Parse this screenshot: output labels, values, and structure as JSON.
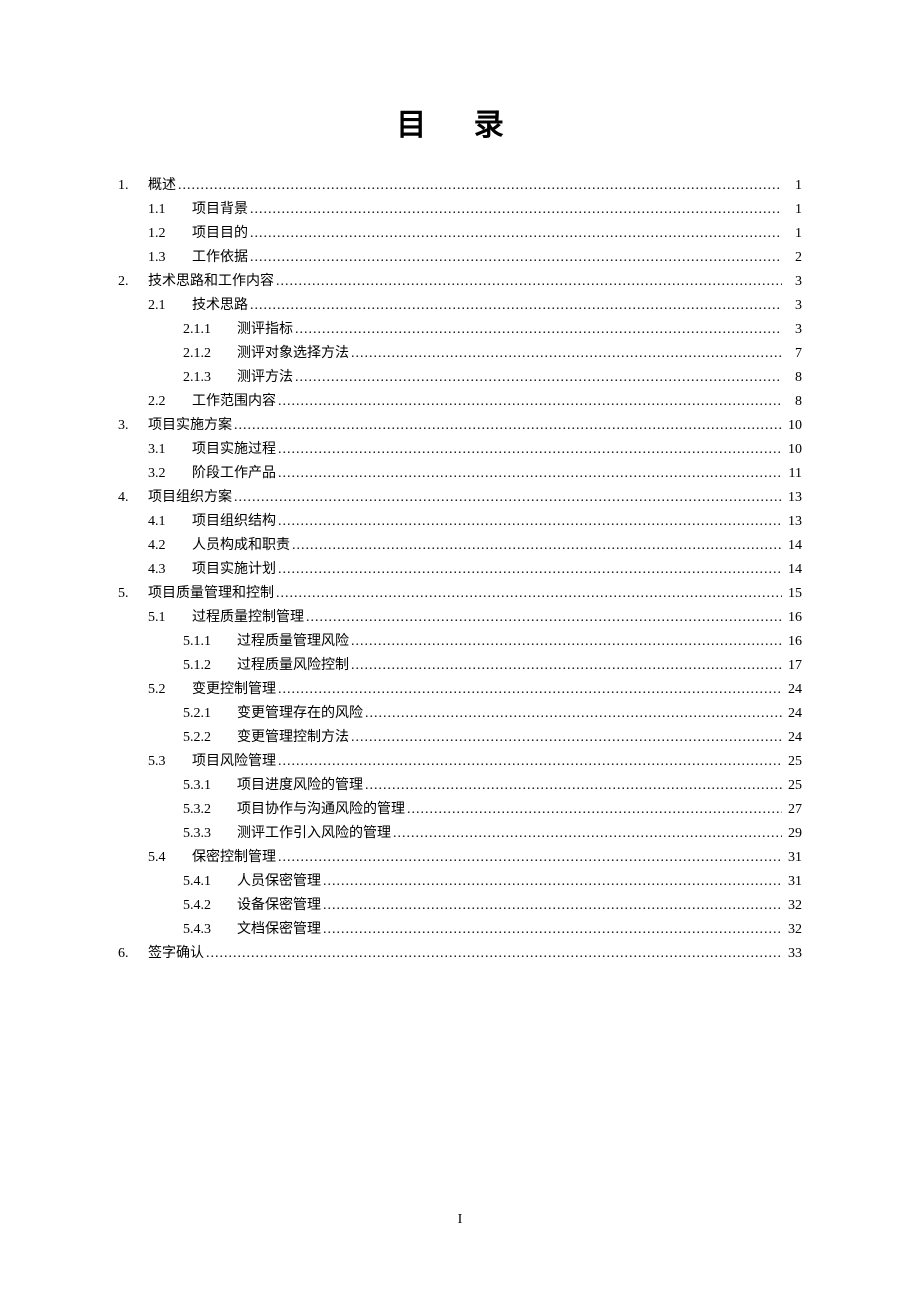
{
  "title": "目 录",
  "footer": "I",
  "entries": [
    {
      "top": "1.",
      "label": "概述",
      "page": "1"
    },
    {
      "sub": "1.1",
      "label": "项目背景",
      "page": "1",
      "indent": 1
    },
    {
      "sub": "1.2",
      "label": "项目目的",
      "page": "1",
      "indent": 1
    },
    {
      "sub": "1.3",
      "label": "工作依据",
      "page": "2",
      "indent": 1
    },
    {
      "top": "2.",
      "label": "技术思路和工作内容",
      "page": "3"
    },
    {
      "sub": "2.1",
      "label": "技术思路",
      "page": "3",
      "indent": 1
    },
    {
      "sub": "2.1.1",
      "label": "测评指标",
      "page": "3",
      "indent": 2
    },
    {
      "sub": "2.1.2",
      "label": "测评对象选择方法",
      "page": "7",
      "indent": 2
    },
    {
      "sub": "2.1.3",
      "label": "测评方法",
      "page": "8",
      "indent": 2
    },
    {
      "sub": "2.2",
      "label": "工作范围内容",
      "page": "8",
      "indent": 1
    },
    {
      "top": "3.",
      "label": "项目实施方案",
      "page": "10"
    },
    {
      "sub": "3.1",
      "label": "项目实施过程",
      "page": "10",
      "indent": 1
    },
    {
      "sub": "3.2",
      "label": "阶段工作产品",
      "page": "11",
      "indent": 1
    },
    {
      "top": "4.",
      "label": "项目组织方案",
      "page": "13"
    },
    {
      "sub": "4.1",
      "label": "项目组织结构",
      "page": "13",
      "indent": 1
    },
    {
      "sub": "4.2",
      "label": "人员构成和职责",
      "page": "14",
      "indent": 1
    },
    {
      "sub": "4.3",
      "label": "项目实施计划",
      "page": "14",
      "indent": 1
    },
    {
      "top": "5.",
      "label": "项目质量管理和控制",
      "page": "15"
    },
    {
      "sub": "5.1",
      "label": "过程质量控制管理",
      "page": "16",
      "indent": 1
    },
    {
      "sub": "5.1.1",
      "label": "过程质量管理风险",
      "page": "16",
      "indent": 2
    },
    {
      "sub": "5.1.2",
      "label": "过程质量风险控制",
      "page": "17",
      "indent": 2
    },
    {
      "sub": "5.2",
      "label": "变更控制管理",
      "page": "24",
      "indent": 1
    },
    {
      "sub": "5.2.1",
      "label": "变更管理存在的风险",
      "page": "24",
      "indent": 2
    },
    {
      "sub": "5.2.2",
      "label": "变更管理控制方法",
      "page": "24",
      "indent": 2
    },
    {
      "sub": "5.3",
      "label": "项目风险管理",
      "page": "25",
      "indent": 1
    },
    {
      "sub": "5.3.1",
      "label": "项目进度风险的管理",
      "page": "25",
      "indent": 2
    },
    {
      "sub": "5.3.2",
      "label": "项目协作与沟通风险的管理",
      "page": "27",
      "indent": 2
    },
    {
      "sub": "5.3.3",
      "label": "测评工作引入风险的管理",
      "page": "29",
      "indent": 2
    },
    {
      "sub": "5.4",
      "label": "保密控制管理",
      "page": "31",
      "indent": 1
    },
    {
      "sub": "5.4.1",
      "label": "人员保密管理",
      "page": "31",
      "indent": 2
    },
    {
      "sub": "5.4.2",
      "label": "设备保密管理",
      "page": "32",
      "indent": 2
    },
    {
      "sub": "5.4.3",
      "label": "文档保密管理",
      "page": "32",
      "indent": 2
    },
    {
      "top": "6.",
      "label": "签字确认",
      "page": "33"
    }
  ]
}
